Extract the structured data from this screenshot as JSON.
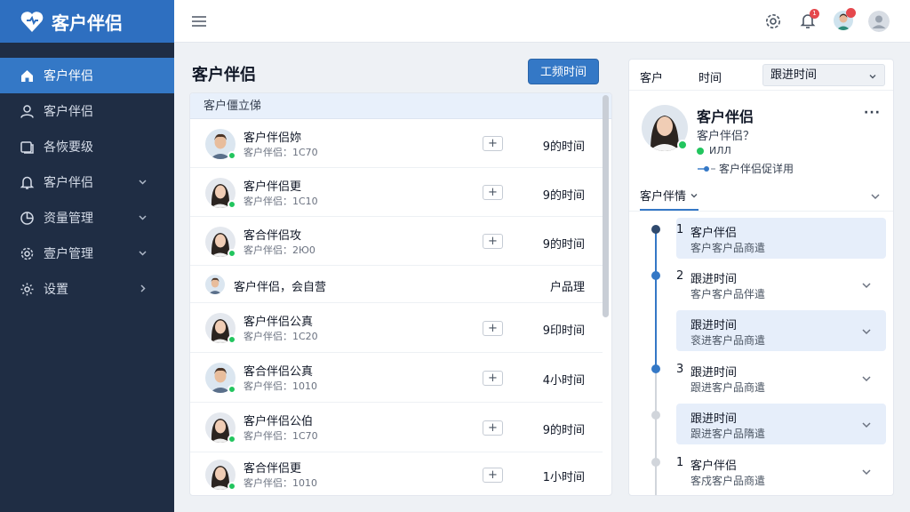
{
  "app": {
    "brand": "客户伴侣",
    "brand_icon": "heart-icon"
  },
  "sidebar": {
    "items": [
      {
        "label": "客户伴侣",
        "icon": "home-icon",
        "active": true
      },
      {
        "label": "客户伴侣",
        "icon": "user-icon"
      },
      {
        "label": "各恢要级",
        "icon": "card-icon"
      },
      {
        "label": "客户伴侣",
        "icon": "bell-icon",
        "chevron": "down"
      },
      {
        "label": "资量管理",
        "icon": "pie-chart-icon",
        "chevron": "down"
      },
      {
        "label": "壹户管理",
        "icon": "gear-icon",
        "chevron": "down"
      },
      {
        "label": "设置",
        "icon": "settings-icon",
        "chevron": "right"
      }
    ]
  },
  "topbar": {
    "menu_icon": "hamburger-icon",
    "settings_icon": "gear-icon",
    "notification_icon": "bell-icon",
    "notification_count": "1"
  },
  "main": {
    "title": "客户伴侣",
    "primary_button": "工频时间",
    "list_header": "客户僵立俤",
    "rows": [
      {
        "name": "客户伴侣妳",
        "sub": "客户伴侣：1С70",
        "time": "9的时间",
        "avatar": "man"
      },
      {
        "name": "客户伴侣更",
        "sub": "客户伴侣：1С10",
        "time": "9的时间",
        "avatar": "woman"
      },
      {
        "name": "客合伴侣攻",
        "sub": "客户伴侣：2Ю0",
        "time": "9的时间",
        "avatar": "woman"
      },
      {
        "name": "客户伴侣，会自营",
        "sub": "",
        "time": "户品理",
        "avatar": "man"
      },
      {
        "name": "客户伴侣公真",
        "sub": "客户伴侣：1С20",
        "time": "9印时间",
        "avatar": "woman"
      },
      {
        "name": "客合伴侣公真",
        "sub": "客户伴侣：1010",
        "time": "4小时间",
        "avatar": "man"
      },
      {
        "name": "客户伴侣公伯",
        "sub": "客户伴侣：1С70",
        "time": "9的时间",
        "avatar": "woman"
      },
      {
        "name": "客合伴侣更",
        "sub": "客户伴侣：1010",
        "time": "1小时间",
        "avatar": "woman"
      }
    ]
  },
  "detail": {
    "tabs": [
      "客户",
      "时间"
    ],
    "select_value": "跟进时间",
    "profile_name": "客户伴侣",
    "profile_sub": "客户伴侣？",
    "profile_status": "ИЛЛ",
    "profile_link": "客户伴侣促详用",
    "section_tab": "客户伴情",
    "timeline": [
      {
        "num": "1",
        "title": "客户伴侣",
        "sub": "客户客户品商遣",
        "highlight": true,
        "dot": "dark"
      },
      {
        "num": "2",
        "title": "跟进时间",
        "sub": "客户客户品伴遣",
        "highlight": false,
        "dot": "blue"
      },
      {
        "num": "",
        "title": "跟进时间",
        "sub": "衮进客户品商遣",
        "highlight": true,
        "dot": ""
      },
      {
        "num": "3",
        "title": "跟进时间",
        "sub": "跟进客户品商遣",
        "highlight": false,
        "dot": "blue"
      },
      {
        "num": "",
        "title": "跟进时间",
        "sub": "跟进客户品隋遣",
        "highlight": true,
        "dot": "gray"
      },
      {
        "num": "1",
        "title": "客户伴侣",
        "sub": "客戍客户品商遣",
        "highlight": false,
        "dot": "gray"
      }
    ]
  },
  "colors": {
    "accent": "#3478c6",
    "sidebar_bg": "#1f2d44",
    "status_online": "#22c55e",
    "badge": "#e5484d"
  }
}
